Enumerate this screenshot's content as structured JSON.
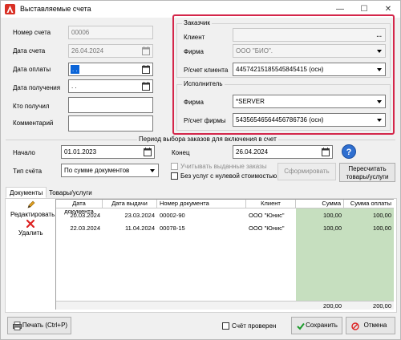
{
  "window": {
    "title": "Выставляемые счета"
  },
  "left_form": {
    "number_label": "Номер счета",
    "number_value": "00006",
    "date_label": "Дата счета",
    "date_value": "26.04.2024",
    "pay_date_label": "Дата оплаты",
    "pay_date_value": " .  .",
    "recv_date_label": "Дата получения",
    "recv_date_value": " .  .",
    "who_label": "Кто получил",
    "who_value": "",
    "comment_label": "Комментарий",
    "comment_value": ""
  },
  "customer": {
    "title": "Заказчик",
    "client_label": "Клиент",
    "client_value": "",
    "client_btn": "...",
    "firm_label": "Фирма",
    "firm_value": "ООО \"БИО\".",
    "account_label": "Р/счет клиента",
    "account_value": "44574215185545845415 (осн)"
  },
  "executor": {
    "title": "Исполнитель",
    "firm_label": "Фирма",
    "firm_value": "*SERVER",
    "account_label": "Р/счет фирмы",
    "account_value": "54356546564456786736 (осн)"
  },
  "period": {
    "title": "Период выбора заказов для включения в счет",
    "start_label": "Начало",
    "start_value": "01.01.2023",
    "end_label": "Конец",
    "end_value": "26.04.2024",
    "type_label": "Тип счёта",
    "type_value": "По сумме документов",
    "consider_issued": "Учитывать выданные заказы",
    "no_zero_services": "Без услуг с нулевой стоимостью",
    "form_btn": "Сформировать",
    "recalc_btn_line1": "Пересчитать",
    "recalc_btn_line2": "товары/услуги",
    "help": "?"
  },
  "tabs": [
    "Документы",
    "Товары/услуги"
  ],
  "side": {
    "edit": "Редактировать",
    "delete": "Удалить"
  },
  "table": {
    "headers": [
      "Дата документа",
      "Дата выдачи",
      "Номер документа",
      "Клиент",
      "Сумма",
      "Сумма оплаты"
    ],
    "rows": [
      [
        "20.03.2024",
        "23.03.2024",
        "00002-90",
        "ООО \"Юнис\"",
        "100,00",
        "100,00"
      ],
      [
        "22.03.2024",
        "11.04.2024",
        "00078-15",
        "ООО \"Юнис\"",
        "100,00",
        "100,00"
      ]
    ],
    "totals": [
      "200,00",
      "200,00"
    ]
  },
  "footer": {
    "print": "Печать (Ctrl+P)",
    "checked": "Счёт проверен",
    "save": "Сохранить",
    "cancel": "Отмена"
  },
  "colors": {
    "accent_red": "#d4264a",
    "selection": "#0a64d8",
    "grid_green": "#c6dfbf",
    "help_blue": "#2f6fd0"
  }
}
